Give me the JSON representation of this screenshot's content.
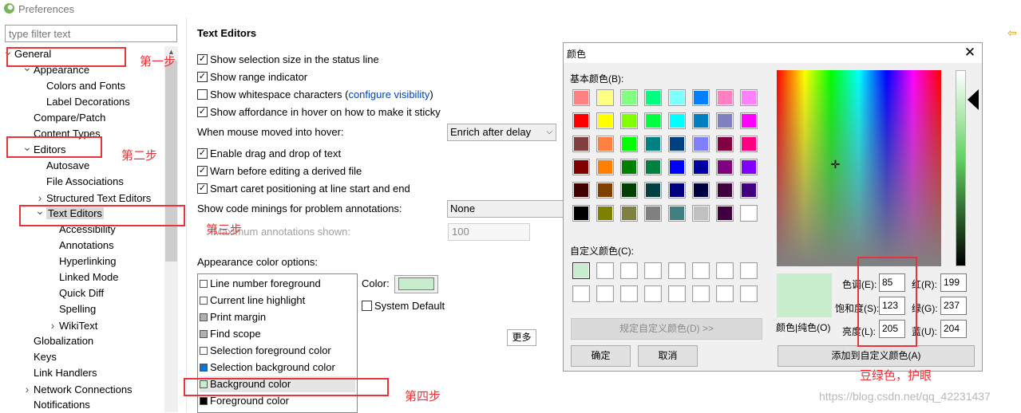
{
  "window": {
    "title": "Preferences"
  },
  "filter": {
    "placeholder": "type filter text"
  },
  "tree": [
    {
      "label": "General",
      "depth": 0,
      "expanded": true
    },
    {
      "label": "Appearance",
      "depth": 1,
      "expanded": true
    },
    {
      "label": "Colors and Fonts",
      "depth": 2
    },
    {
      "label": "Label Decorations",
      "depth": 2
    },
    {
      "label": "Compare/Patch",
      "depth": 1
    },
    {
      "label": "Content Types",
      "depth": 1
    },
    {
      "label": "Editors",
      "depth": 1,
      "expanded": true
    },
    {
      "label": "Autosave",
      "depth": 2
    },
    {
      "label": "File Associations",
      "depth": 2
    },
    {
      "label": "Structured Text Editors",
      "depth": 2,
      "collapsed": true
    },
    {
      "label": "Text Editors",
      "depth": 2,
      "expanded": true,
      "selected": true
    },
    {
      "label": "Accessibility",
      "depth": 3
    },
    {
      "label": "Annotations",
      "depth": 3
    },
    {
      "label": "Hyperlinking",
      "depth": 3
    },
    {
      "label": "Linked Mode",
      "depth": 3
    },
    {
      "label": "Quick Diff",
      "depth": 3
    },
    {
      "label": "Spelling",
      "depth": 3
    },
    {
      "label": "WikiText",
      "depth": 3,
      "collapsed": true
    },
    {
      "label": "Globalization",
      "depth": 1
    },
    {
      "label": "Keys",
      "depth": 1
    },
    {
      "label": "Link Handlers",
      "depth": 1
    },
    {
      "label": "Network Connections",
      "depth": 1,
      "collapsed": true
    },
    {
      "label": "Notifications",
      "depth": 1
    }
  ],
  "prefs": {
    "title": "Text Editors",
    "opt_selection_size": "Show selection size in the status line",
    "opt_range": "Show range indicator",
    "opt_whitespace": "Show whitespace characters",
    "opt_whitespace_link": "configure visibility",
    "opt_whitespace_paren_open": "(",
    "opt_whitespace_paren_close": ")",
    "opt_affordance": "Show affordance in hover on how to make it sticky",
    "hover_label": "When mouse moved into hover:",
    "hover_value": "Enrich after delay",
    "opt_dnd": "Enable drag and drop of text",
    "opt_warn": "Warn before editing a derived file",
    "opt_caret": "Smart caret positioning at line start and end",
    "minings_label": "Show code minings for problem annotations:",
    "minings_value": "None",
    "max_ann_label": "Maximum annotations shown:",
    "max_ann_value": "100",
    "appearance_label": "Appearance color options:",
    "color_label": "Color:",
    "system_default": "System Default",
    "more_btn": "更多"
  },
  "color_options": [
    {
      "label": "Line number foreground",
      "swatch": "#ffffff"
    },
    {
      "label": "Current line highlight",
      "swatch": "#ffffff"
    },
    {
      "label": "Print margin",
      "swatch": "#b0b0b0"
    },
    {
      "label": "Find scope",
      "swatch": "#b0b0b0"
    },
    {
      "label": "Selection foreground color",
      "swatch": "#ffffff"
    },
    {
      "label": "Selection background color",
      "swatch": "#0078d7"
    },
    {
      "label": "Background color",
      "swatch": "#c7edcc",
      "selected": true
    },
    {
      "label": "Foreground color",
      "swatch": "#000000"
    }
  ],
  "annotations": {
    "step1": "第一步",
    "step2": "第二步",
    "step3": "第三步",
    "step4": "第四步",
    "note": "豆绿色，护眼"
  },
  "dialog": {
    "title": "颜色",
    "basic_label": "基本颜色(B):",
    "custom_label": "自定义颜色(C):",
    "define_btn": "规定自定义颜色(D) >>",
    "ok_btn": "确定",
    "cancel_btn": "取消",
    "add_btn": "添加到自定义颜色(A)",
    "preview_label": "颜色|纯色(O)",
    "hue_label": "色调(E):",
    "hue": "85",
    "sat_label": "饱和度(S):",
    "sat": "123",
    "lum_label": "亮度(L):",
    "lum": "205",
    "red_label": "红(R):",
    "red": "199",
    "green_label": "绿(G):",
    "green": "237",
    "blue_label": "蓝(U):",
    "blue": "204",
    "basic_colors": [
      "#ff8080",
      "#ffff80",
      "#80ff80",
      "#00ff80",
      "#80ffff",
      "#0080ff",
      "#ff80c0",
      "#ff80ff",
      "#ff0000",
      "#ffff00",
      "#80ff00",
      "#00ff40",
      "#00ffff",
      "#0080c0",
      "#8080c0",
      "#ff00ff",
      "#804040",
      "#ff8040",
      "#00ff00",
      "#008080",
      "#004080",
      "#8080ff",
      "#800040",
      "#ff0080",
      "#800000",
      "#ff8000",
      "#008000",
      "#008040",
      "#0000ff",
      "#0000a0",
      "#800080",
      "#8000ff",
      "#400000",
      "#804000",
      "#004000",
      "#004040",
      "#000080",
      "#000040",
      "#400040",
      "#400080",
      "#000000",
      "#808000",
      "#808040",
      "#808080",
      "#408080",
      "#c0c0c0",
      "#400040",
      "#ffffff"
    ],
    "custom_colors": [
      "#c7edcc",
      "#ffffff",
      "#ffffff",
      "#ffffff",
      "#ffffff",
      "#ffffff",
      "#ffffff",
      "#ffffff",
      "#ffffff",
      "#ffffff",
      "#ffffff",
      "#ffffff",
      "#ffffff",
      "#ffffff",
      "#ffffff",
      "#ffffff"
    ]
  },
  "watermark": "https://blog.csdn.net/qq_42231437"
}
